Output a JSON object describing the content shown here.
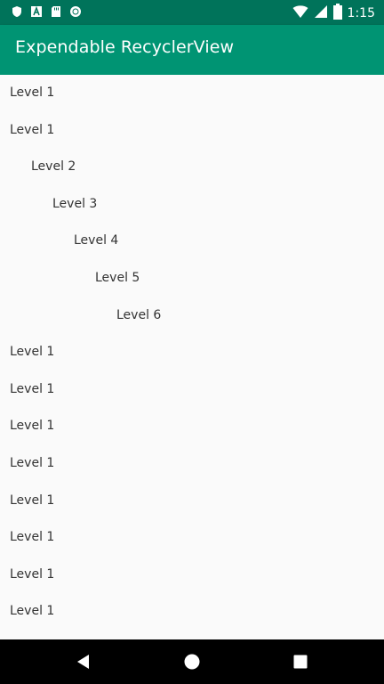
{
  "status_bar": {
    "time": "1:15",
    "left_icons": [
      "shield-icon",
      "font-a-icon",
      "sd-card-icon",
      "record-icon"
    ],
    "right_icons": [
      "wifi-icon",
      "signal-icon",
      "battery-icon"
    ]
  },
  "app_bar": {
    "title": "Expendable RecyclerView",
    "color": "#009473",
    "status_color": "#00735a"
  },
  "list": {
    "items": [
      {
        "label": "Level 1",
        "level": 1
      },
      {
        "label": "Level 1",
        "level": 1
      },
      {
        "label": "Level 2",
        "level": 2
      },
      {
        "label": "Level 3",
        "level": 3
      },
      {
        "label": "Level 4",
        "level": 4
      },
      {
        "label": "Level 5",
        "level": 5
      },
      {
        "label": "Level 6",
        "level": 6
      },
      {
        "label": "Level 1",
        "level": 1
      },
      {
        "label": "Level 1",
        "level": 1
      },
      {
        "label": "Level 1",
        "level": 1
      },
      {
        "label": "Level 1",
        "level": 1
      },
      {
        "label": "Level 1",
        "level": 1
      },
      {
        "label": "Level 1",
        "level": 1
      },
      {
        "label": "Level 1",
        "level": 1
      },
      {
        "label": "Level 1",
        "level": 1
      }
    ]
  },
  "nav_bar": {
    "buttons": [
      "back-icon",
      "home-icon",
      "recents-icon"
    ]
  }
}
